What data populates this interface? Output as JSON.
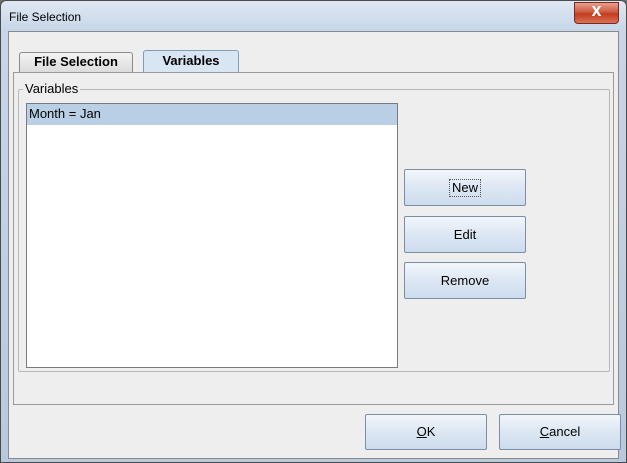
{
  "window": {
    "title": "File Selection",
    "close_glyph": "X"
  },
  "tabs": [
    {
      "label": "File Selection",
      "active": false
    },
    {
      "label": "Variables",
      "active": true
    }
  ],
  "variables_group": {
    "title": "Variables",
    "items": [
      {
        "text": "Month = Jan",
        "selected": true
      }
    ]
  },
  "side_buttons": {
    "new_label": "New",
    "edit_label": "Edit",
    "remove_label": "Remove"
  },
  "dialog_buttons": {
    "ok_mnemonic": "O",
    "ok_rest": "K",
    "cancel_mnemonic": "C",
    "cancel_rest": "ancel"
  },
  "colors": {
    "selection": "#b8cfe5",
    "active_tab": "#d8e5f3",
    "close_button": "#c23a1d"
  }
}
